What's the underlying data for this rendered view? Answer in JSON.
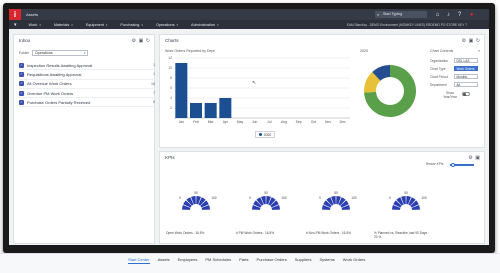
{
  "topbar": {
    "app_name": "Assets",
    "search_placeholder": "Start Typing",
    "icons": [
      "search-icon",
      "home-icon",
      "bell-icon",
      "help-icon",
      "user-icon"
    ]
  },
  "nav": {
    "items": [
      "Work",
      "Materials",
      "Equipment",
      "Purchasing",
      "Operations",
      "Administration"
    ],
    "site_info": "EAM Stand/cy - DEMO Environment (MONKEY LINES) ERDEMO PO STORE KEY 7"
  },
  "inbox": {
    "title": "Inbox",
    "folder_label": "Folder",
    "folder_value": "Operations",
    "items": [
      {
        "label": "Inspection Results Awaiting Approval",
        "count": "1"
      },
      {
        "label": "Requisitions Awaiting Approval",
        "count": "1"
      },
      {
        "label": "All Overdue Work Orders",
        "count": "16"
      },
      {
        "label": "Overdue PM Work Orders",
        "count": "7"
      },
      {
        "label": "Purchase Orders Partially Received",
        "count": "6"
      }
    ]
  },
  "charts": {
    "title": "Charts",
    "controls_title": "Chart Controls",
    "controls": [
      {
        "label": "Organization",
        "value": "DSL LAS",
        "highlight": false
      },
      {
        "label": "Chart Type",
        "value": "Work Orders",
        "highlight": true
      },
      {
        "label": "Chart Period",
        "value": "Months",
        "highlight": false
      },
      {
        "label": "Department",
        "value": "All",
        "highlight": false
      }
    ],
    "toggle_label": "Show Year/Year"
  },
  "chart_data": [
    {
      "type": "bar",
      "title": "Work Orders Reported by Dept",
      "categories": [
        "Jan",
        "Feb",
        "Mar",
        "Apr",
        "May",
        "Jun",
        "Jul",
        "Aug",
        "Sep",
        "Oct",
        "Nov",
        "Dec"
      ],
      "series": [
        {
          "name": "2020",
          "values": [
            11,
            3,
            3,
            4,
            0,
            0,
            0,
            0,
            0,
            0,
            0,
            0
          ]
        }
      ],
      "ylim": [
        0,
        12
      ],
      "yticks": [
        2,
        4,
        6,
        8,
        10,
        12
      ],
      "grid": true,
      "legend": "bottom",
      "color": "#1c4f92"
    },
    {
      "type": "pie",
      "title": "2020",
      "slices": [
        {
          "value": 74,
          "color": "#5aa04a"
        },
        {
          "value": 14,
          "color": "#e8c13a"
        },
        {
          "value": 12,
          "color": "#234d8e"
        }
      ]
    }
  ],
  "kpis": {
    "title": "KPIs",
    "resize_label": "Resize KPIs",
    "items": [
      {
        "label": "Open Work Orders : 16.5%",
        "tick_min": "0",
        "tick_mid": "50",
        "tick_max": "100"
      },
      {
        "label": "# PM Work Orders : 16.5%",
        "tick_min": "0",
        "tick_mid": "50",
        "tick_max": "100"
      },
      {
        "label": "# Non-PM Work Orders : 16.5%",
        "tick_min": "0",
        "tick_mid": "50",
        "tick_max": "100"
      },
      {
        "label": "% Planned vs. Reactive, last 90 Days : 20 %",
        "tick_min": "0",
        "tick_mid": "50",
        "tick_max": "100"
      }
    ]
  },
  "tabs": [
    "Start Center",
    "Assets",
    "Employees",
    "PM Schedules",
    "Parts",
    "Purchase Orders",
    "Suppliers",
    "Systems",
    "Work Orders"
  ],
  "active_tab": "Start Center"
}
